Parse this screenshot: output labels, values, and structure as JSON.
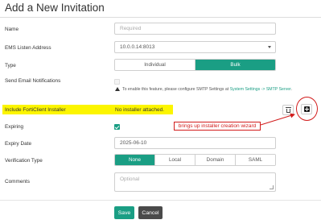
{
  "dialog": {
    "title": "Add a New Invitation"
  },
  "fields": {
    "name": {
      "label": "Name",
      "placeholder": "Required"
    },
    "ems_address": {
      "label": "EMS Listen Address",
      "value": "10.0.0.14:8013"
    },
    "type": {
      "label": "Type",
      "options": [
        "Individual",
        "Bulk"
      ],
      "selected": "Bulk"
    },
    "send_email": {
      "label": "Send Email Notifications",
      "note_prefix": "To enable this feature, please configure SMTP Settings at ",
      "note_link": "System Settings -> SMTP Server",
      "note_suffix": "."
    },
    "installer": {
      "label": "Include FortiClient Installer",
      "value": "No installer attached."
    },
    "expiring": {
      "label": "Expiring",
      "checked": true
    },
    "expiry_date": {
      "label": "Expiry Date",
      "value": "2025-06-10"
    },
    "verification": {
      "label": "Verification Type",
      "options": [
        "None",
        "Local",
        "Domain",
        "SAML"
      ],
      "selected": "None"
    },
    "comments": {
      "label": "Comments",
      "placeholder": "Optional"
    }
  },
  "annotation": {
    "callout": "brings up installer creation wizard",
    "color": "#d21c1c",
    "highlight_color": "#fcf500"
  },
  "footer": {
    "save": "Save",
    "cancel": "Cancel"
  },
  "colors": {
    "accent": "#1a9e84",
    "cancel": "#4a4a4a"
  }
}
